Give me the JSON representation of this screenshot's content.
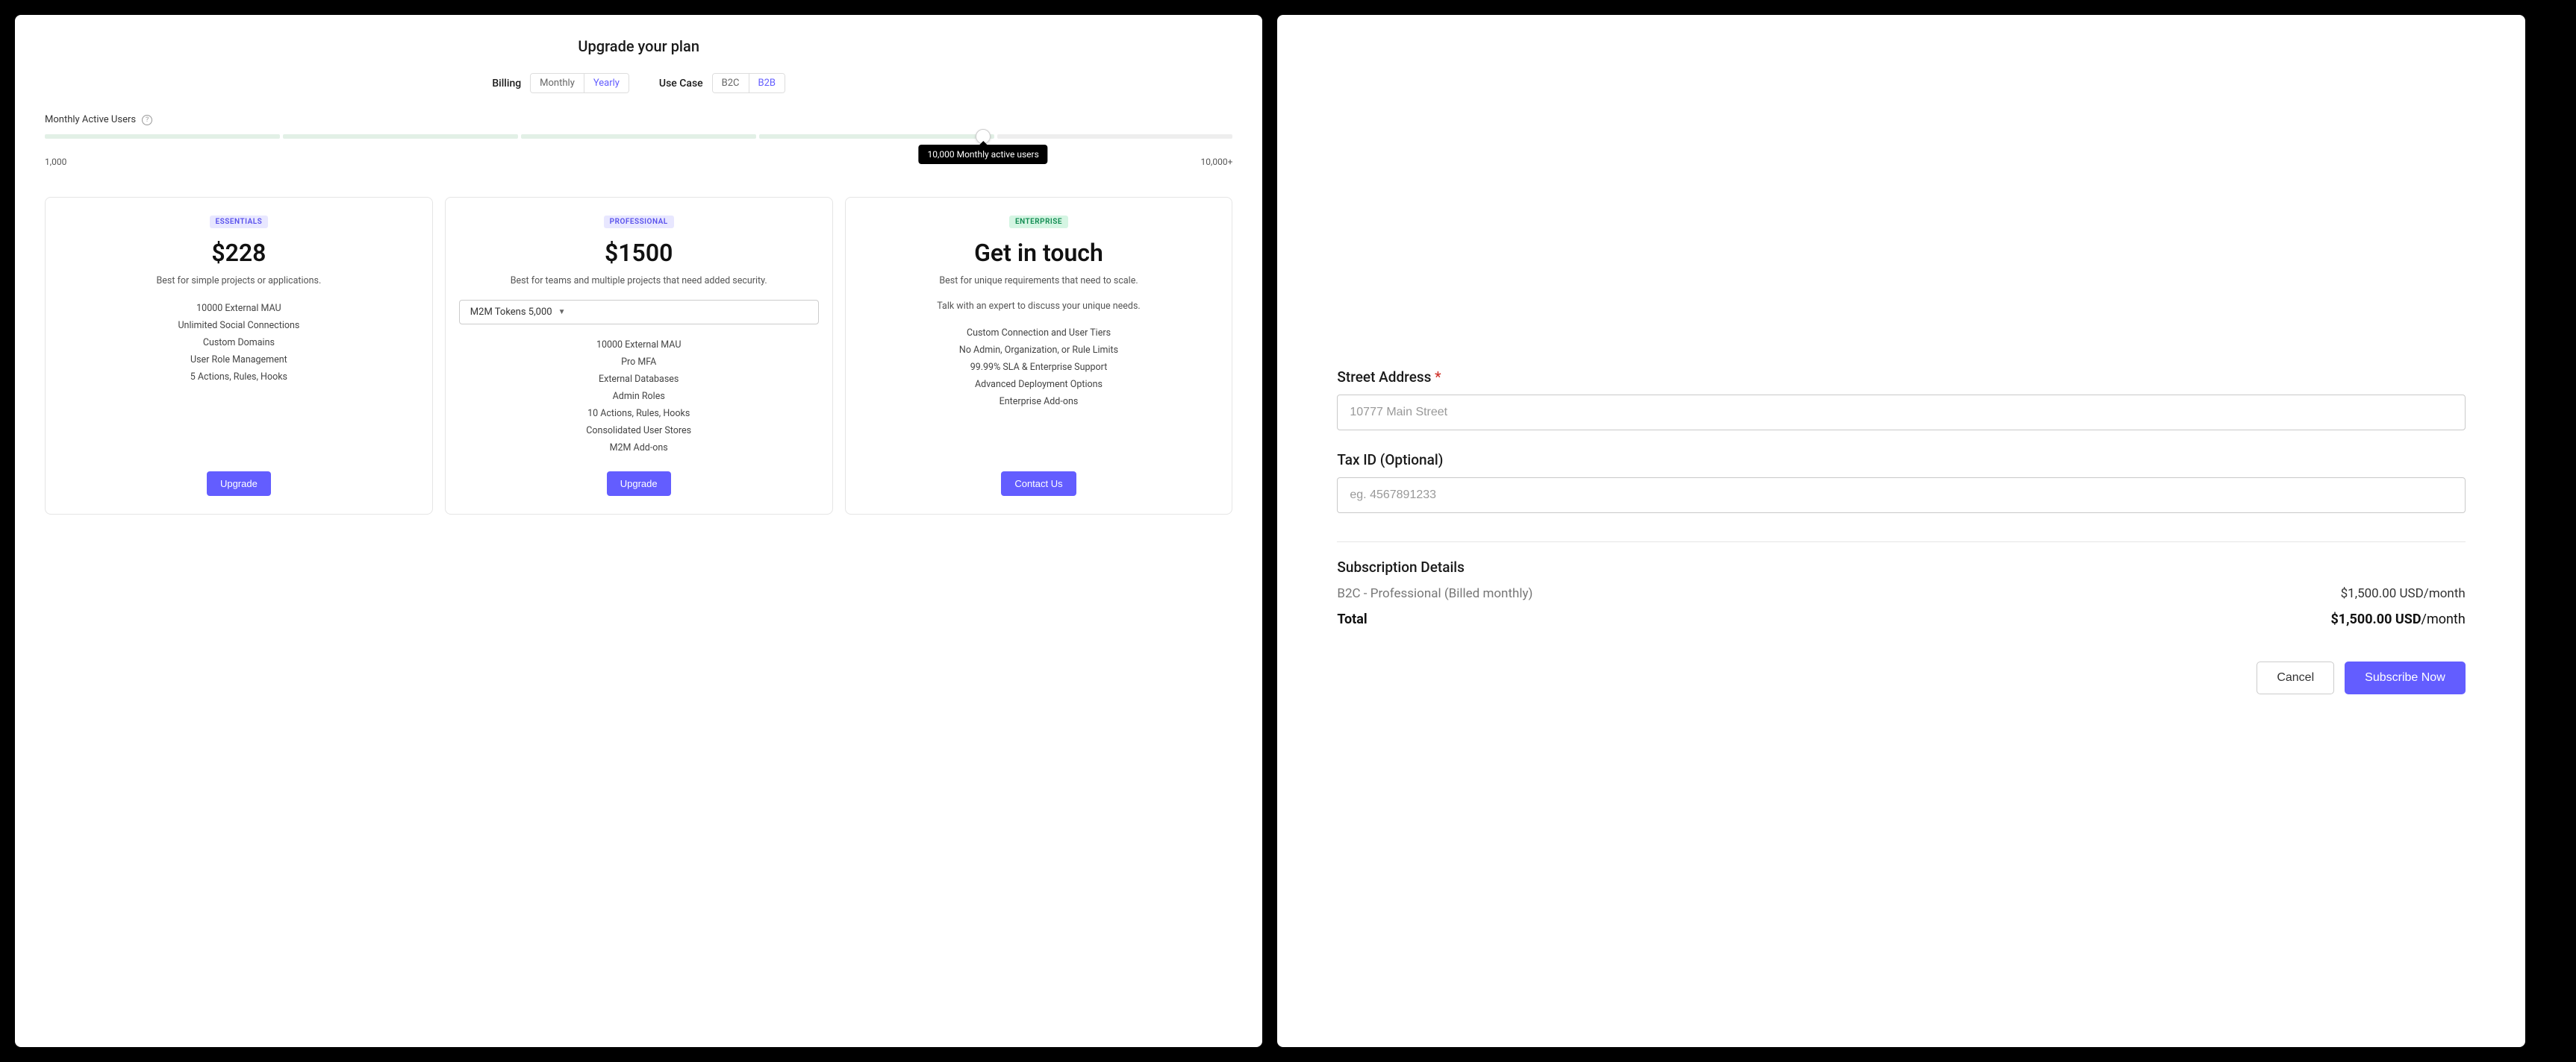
{
  "left": {
    "title": "Upgrade your plan",
    "billing_label": "Billing",
    "billing_options": {
      "monthly": "Monthly",
      "yearly": "Yearly"
    },
    "usecase_label": "Use Case",
    "usecase_options": {
      "b2c": "B2C",
      "b2b": "B2B"
    },
    "mau_label": "Monthly Active Users",
    "slider_min": "1,000",
    "slider_max": "10,000+",
    "slider_tooltip": "10,000 Monthly active users",
    "plans": [
      {
        "tier": "ESSENTIALS",
        "price": "$228",
        "desc": "Best for simple projects or applications.",
        "features": [
          "10000 External MAU",
          "Unlimited Social Connections",
          "Custom Domains",
          "User Role Management",
          "5 Actions, Rules, Hooks"
        ],
        "cta": "Upgrade"
      },
      {
        "tier": "PROFESSIONAL",
        "price": "$1500",
        "desc": "Best for teams and multiple projects that need added security.",
        "m2m_label": "M2M Tokens 5,000",
        "features": [
          "10000 External MAU",
          "Pro MFA",
          "External Databases",
          "Admin Roles",
          "10 Actions, Rules, Hooks",
          "Consolidated User Stores",
          "M2M Add-ons"
        ],
        "cta": "Upgrade"
      },
      {
        "tier": "ENTERPRISE",
        "price": "Get in touch",
        "desc": "Best for unique requirements that need to scale.",
        "sub_desc": "Talk with an expert to discuss your unique needs.",
        "features": [
          "Custom Connection and User Tiers",
          "No Admin, Organization, or Rule Limits",
          "99.99% SLA & Enterprise Support",
          "Advanced Deployment Options",
          "Enterprise Add-ons"
        ],
        "cta": "Contact Us"
      }
    ]
  },
  "right": {
    "street_label": "Street Address",
    "street_placeholder": "10777 Main Street",
    "tax_label": "Tax ID (Optional)",
    "tax_placeholder": "eg. 4567891233",
    "sub_title": "Subscription Details",
    "sub_plan": "B2C - Professional (Billed monthly)",
    "sub_price": "$1,500.00 USD/month",
    "total_label": "Total",
    "total_price_bold": "$1,500.00 USD",
    "total_price_suffix": "/month",
    "cancel": "Cancel",
    "subscribe": "Subscribe Now"
  }
}
